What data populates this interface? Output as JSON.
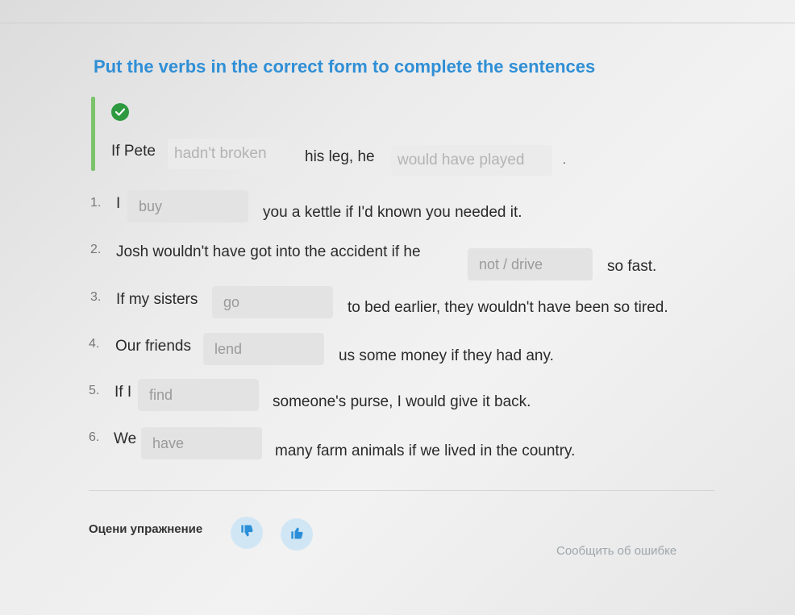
{
  "header": {
    "title": "Put the verbs in the correct form to complete the sentences"
  },
  "example": {
    "before": "If Pete",
    "answer1": "hadn't broken",
    "middle": "his leg, he",
    "answer2": "would have played",
    "end": "."
  },
  "items": [
    {
      "num": "1.",
      "before": "I",
      "placeholder": "buy",
      "after": "you a kettle if I'd known you needed it."
    },
    {
      "num": "2.",
      "before": "Josh wouldn't have got into the accident if he",
      "placeholder": "not / drive",
      "after": "so fast."
    },
    {
      "num": "3.",
      "before": "If my sisters",
      "placeholder": "go",
      "after": "to bed earlier, they wouldn't have been so tired."
    },
    {
      "num": "4.",
      "before": "Our friends",
      "placeholder": "lend",
      "after": "us some money if they had any."
    },
    {
      "num": "5.",
      "before": "If I",
      "placeholder": "find",
      "after": "someone's purse, I would give it back."
    },
    {
      "num": "6.",
      "before": "We",
      "placeholder": "have",
      "after": "many farm animals if we lived in the country."
    }
  ],
  "footer": {
    "rate_label": "Оцени упражнение",
    "report_link": "Сообщить об ошибке"
  },
  "icons": {
    "check": "check-circle-icon",
    "dislike": "thumbs-down-icon",
    "like": "thumbs-up-icon"
  },
  "colors": {
    "title": "#2f8fd6",
    "check": "#2e9a3f",
    "accent_bar": "#7cc36b",
    "rate_button": "#d1e6f4",
    "rate_icon": "#2a8fd8"
  }
}
